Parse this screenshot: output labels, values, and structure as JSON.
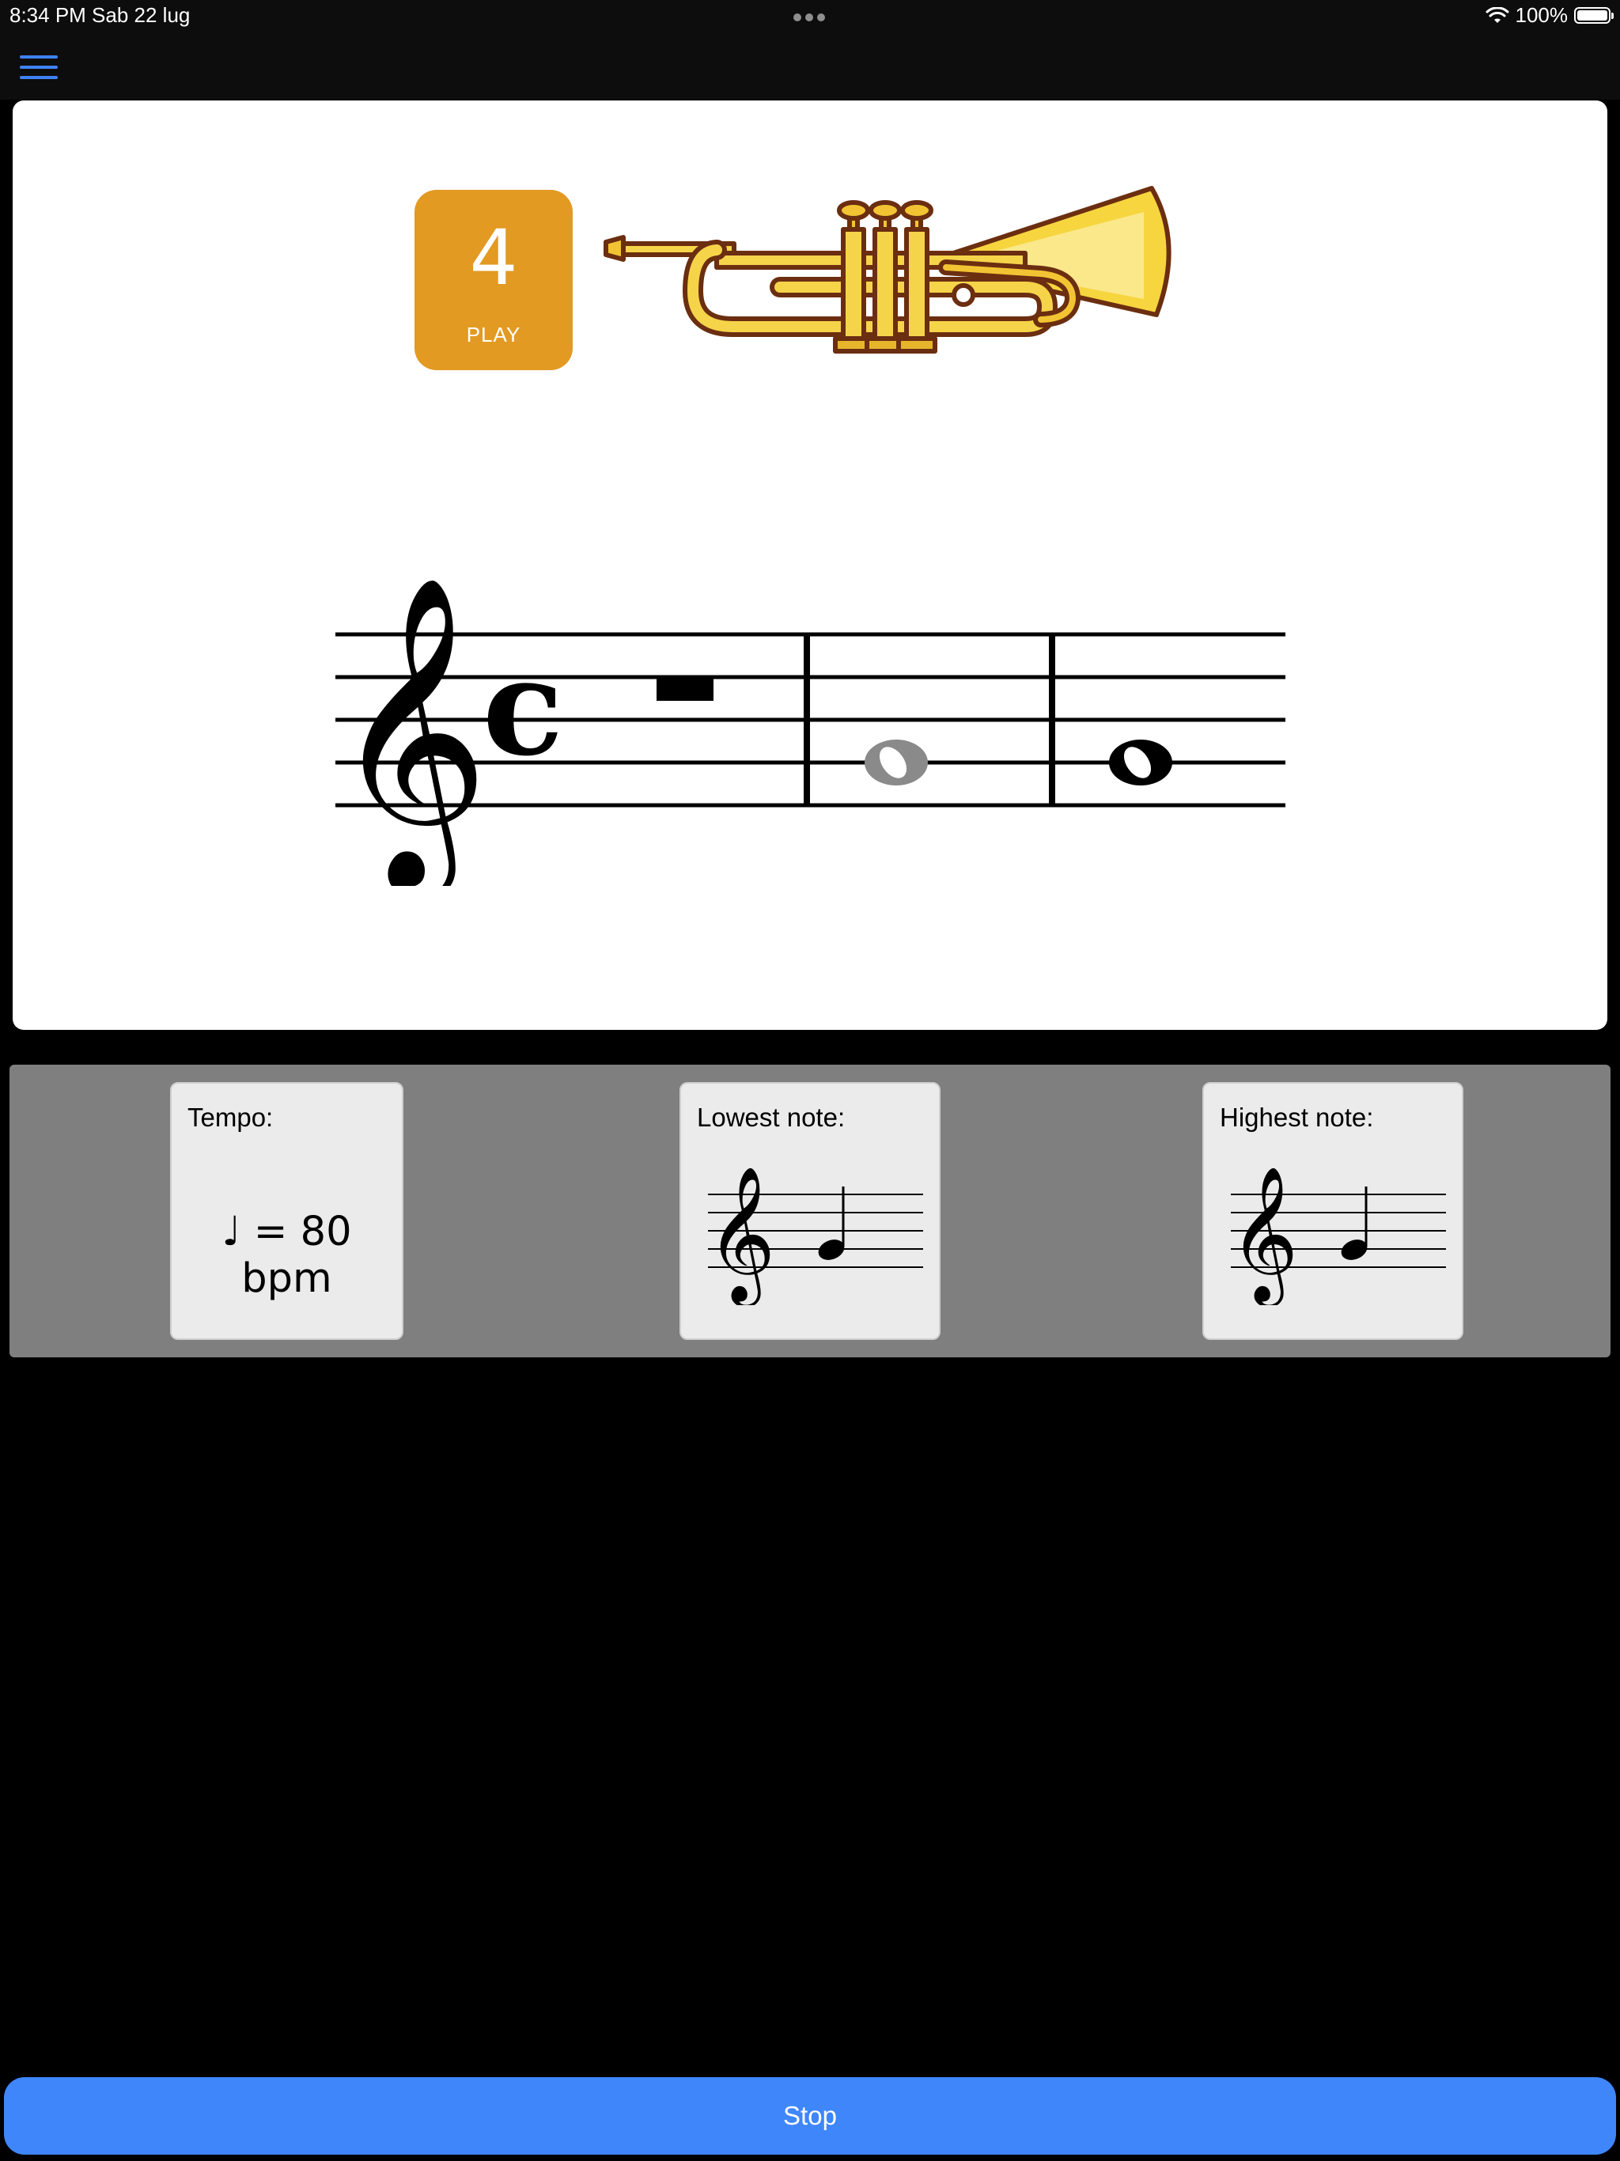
{
  "status_bar": {
    "time_date": "8:34 PM   Sab 22 lug",
    "battery": "100%",
    "icons": [
      "more-dots-icon",
      "wifi-icon",
      "battery-icon"
    ]
  },
  "nav": {
    "menu_icon": "hamburger-menu-icon"
  },
  "play_badge": {
    "count": "4",
    "label": "PLAY"
  },
  "instrument": {
    "name_icon": "trumpet-icon"
  },
  "score": {
    "clef": "treble",
    "time_signature": "C",
    "measures": [
      {
        "content": "whole rest"
      },
      {
        "content": "whole note",
        "pitch": "G4",
        "state": "played"
      },
      {
        "content": "whole note",
        "pitch": "G4",
        "state": "upcoming"
      }
    ]
  },
  "settings": {
    "tempo": {
      "title": "Tempo:",
      "value": "♩ = 80 bpm"
    },
    "lowest": {
      "title": "Lowest note:",
      "pitch": "G4"
    },
    "highest": {
      "title": "Highest note:",
      "pitch": "G4"
    }
  },
  "actions": {
    "stop_label": "Stop"
  },
  "colors": {
    "accent": "#3f86fb",
    "play_badge": "#e29a22",
    "panel": "#7f7f7f",
    "played_note": "#8a8a8a"
  }
}
